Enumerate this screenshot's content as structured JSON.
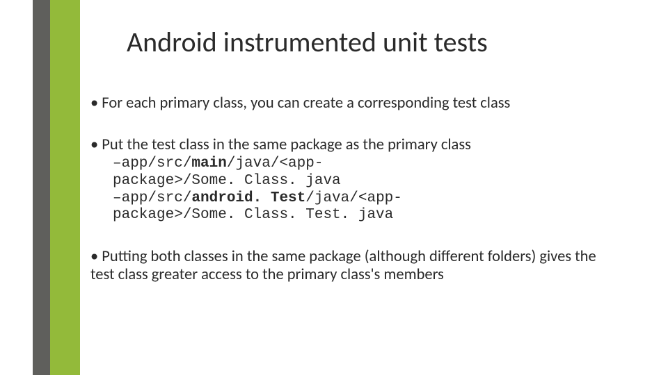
{
  "title": "Android instrumented unit tests",
  "bullets": {
    "b1": "• For each primary class, you can create a corresponding test class",
    "b2": "• Put the test class in the same package as the primary class",
    "b3": "• Putting both classes in the same package (although different folders) gives the test class greater access to the primary class's members"
  },
  "code": {
    "l1a": "–app/src/",
    "l1b": "main",
    "l1c": "/java/<app-",
    "l2": "package>/Some. Class. java",
    "l3a": "–app/src/",
    "l3b": "android. Test",
    "l3c": "/java/<app-",
    "l4": "package>/Some. Class. Test. java"
  }
}
